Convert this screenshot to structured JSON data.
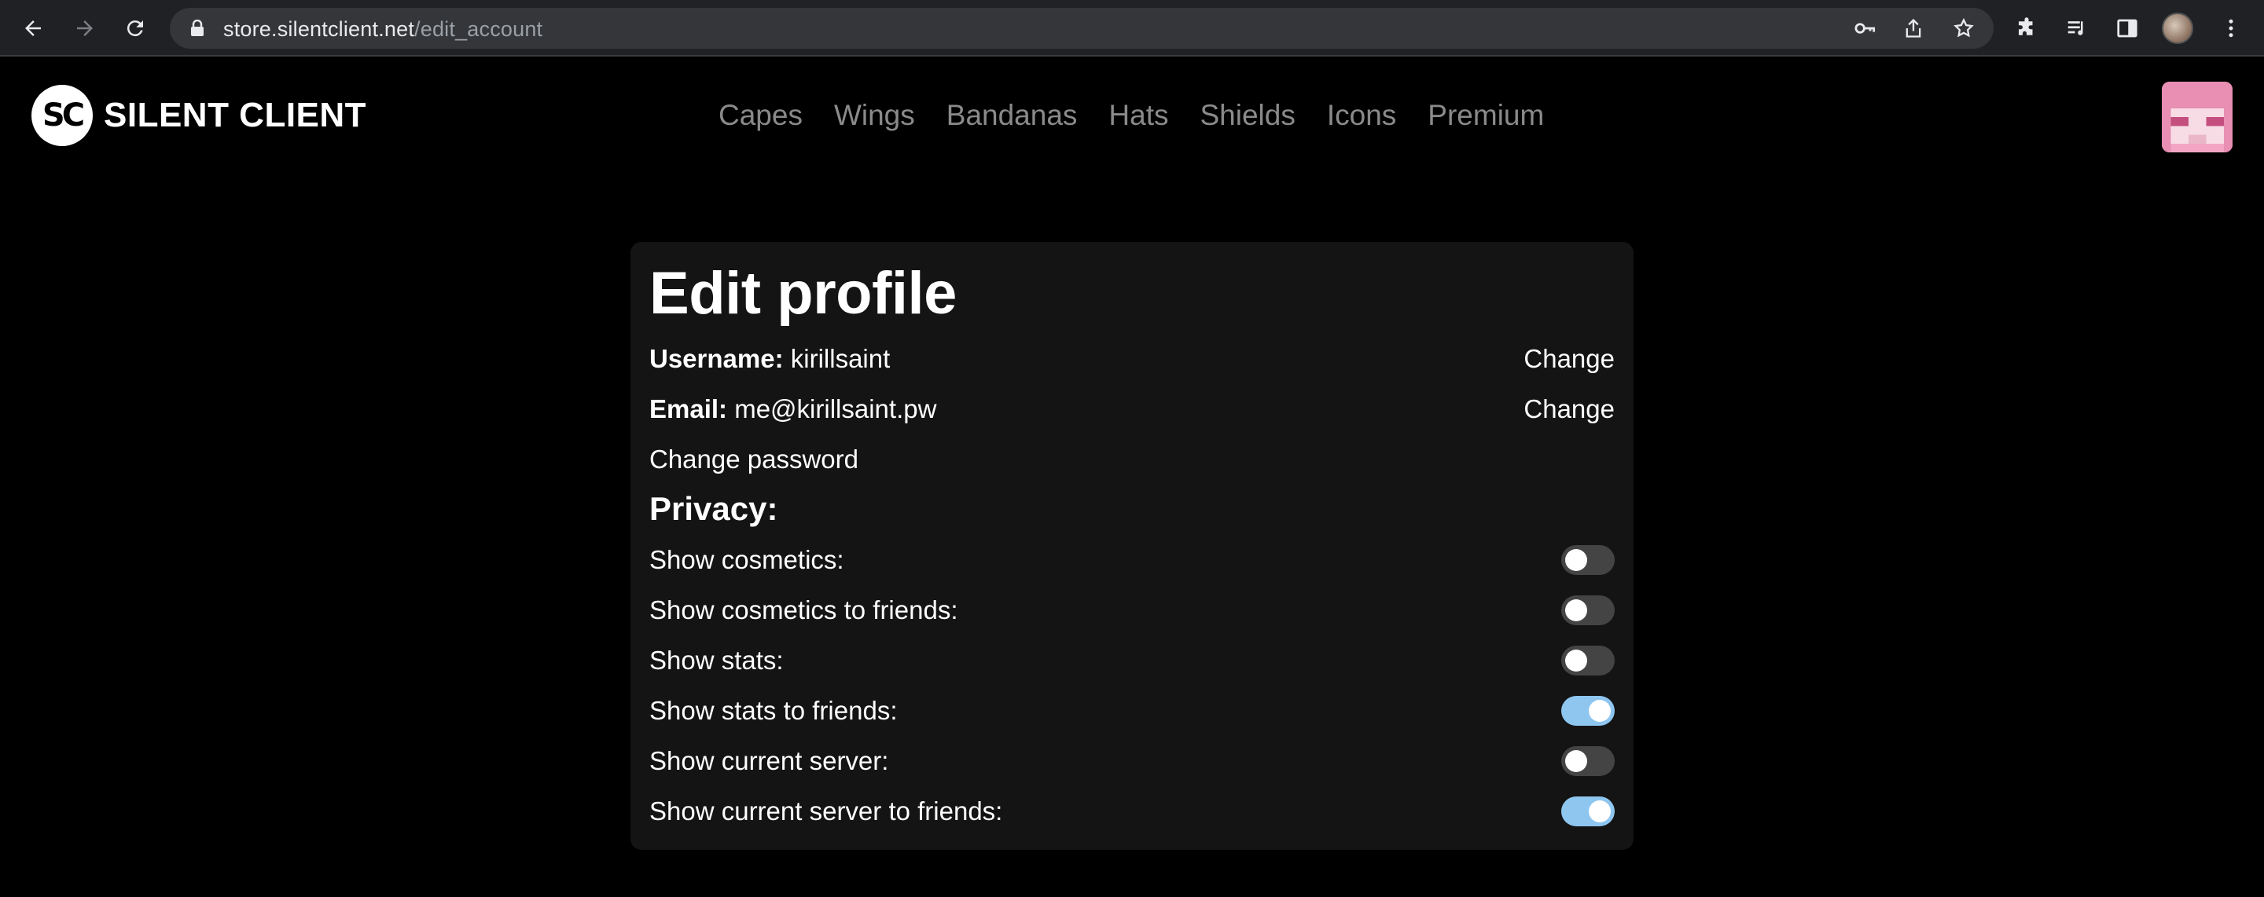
{
  "browser": {
    "url_host": "store.silentclient.net",
    "url_path": "/edit_account"
  },
  "site": {
    "logo_mark": "SC",
    "logo_text": "SILENT CLIENT",
    "nav": [
      "Capes",
      "Wings",
      "Bandanas",
      "Hats",
      "Shields",
      "Icons",
      "Premium"
    ]
  },
  "profile": {
    "title": "Edit profile",
    "username_label": "Username:",
    "username_value": "kirillsaint",
    "email_label": "Email:",
    "email_value": "me@kirillsaint.pw",
    "change_label": "Change",
    "change_password_label": "Change password",
    "privacy_heading": "Privacy:",
    "privacy_settings": [
      {
        "label": "Show cosmetics:",
        "enabled": false
      },
      {
        "label": "Show cosmetics to friends:",
        "enabled": false
      },
      {
        "label": "Show stats:",
        "enabled": false
      },
      {
        "label": "Show stats to friends:",
        "enabled": true
      },
      {
        "label": "Show current server:",
        "enabled": false
      },
      {
        "label": "Show current server to friends:",
        "enabled": true
      }
    ]
  },
  "colors": {
    "toggle_on": "#8ec6f0",
    "toggle_off": "#444444",
    "card_bg": "#141414"
  }
}
